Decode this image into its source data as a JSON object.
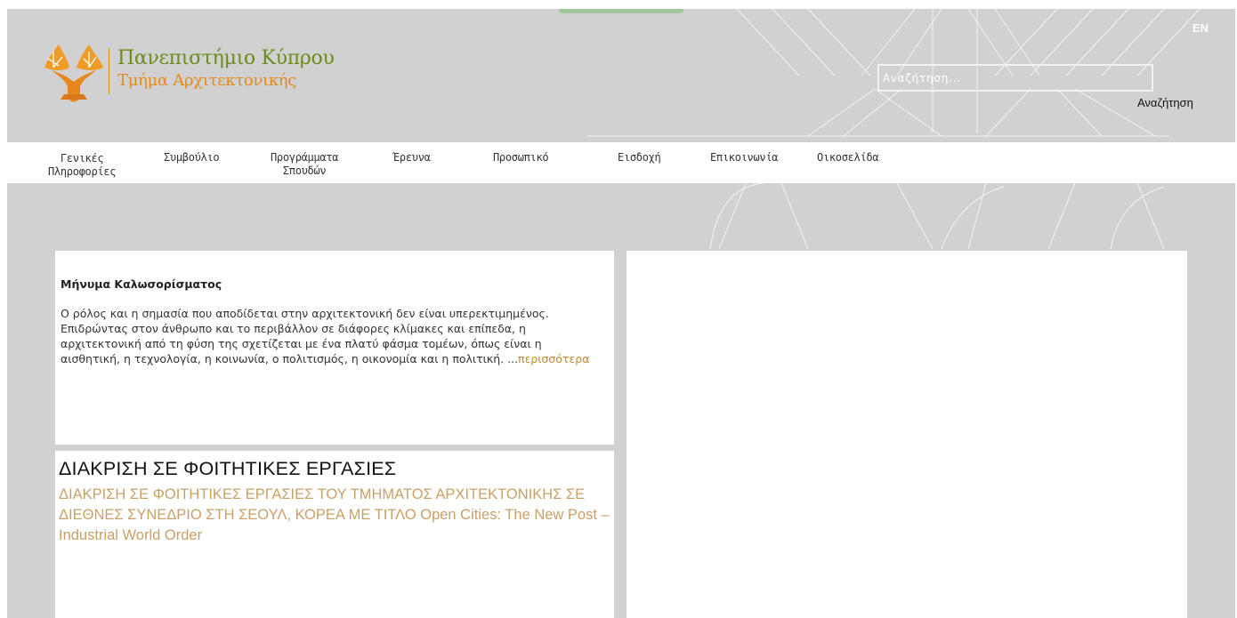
{
  "header": {
    "logo_title": "Πανεπιστήμιο Κύπρου",
    "logo_subtitle": "Τμήμα Αρχιτεκτονικής",
    "logo_icon": "university-trees-logo",
    "language_switch": "EN",
    "search": {
      "placeholder": "Αναζήτηση...",
      "value": "",
      "button_label": "Αναζήτηση"
    }
  },
  "nav": {
    "items": [
      {
        "label": "Γενικές\nΠληροφορίες"
      },
      {
        "label": "Συμβούλιο"
      },
      {
        "label": "Προγράμματα\nΣπουδών"
      },
      {
        "label": "Έρευνα"
      },
      {
        "label": "Προσωπικό"
      },
      {
        "label": "Εισδοχή"
      },
      {
        "label": "Επικοινωνία"
      },
      {
        "label": "Οικοσελίδα"
      }
    ]
  },
  "welcome": {
    "heading": "Μήνυμα Καλωσορίσματος",
    "body": "Ο ρόλος και η σημασία που αποδίδεται στην αρχιτεκτονική δεν είναι υπερεκτιμημένος. Επιδρώντας στον άνθρωπο και το περιβάλλον σε διάφορες κλίμακες και επίπεδα, η αρχιτεκτονική από τη φύση της σχετίζεται με ένα πλατύ φάσμα τομέων, όπως είναι η αισθητική, η τεχνολογία, η κοινωνία, ο πολιτισμός, η οικονομία και η πολιτική. ...",
    "more_link": "περισσότερα"
  },
  "news": {
    "title": "ΔΙΑΚΡΙΣΗ ΣΕ ΦΟΙΤΗΤΙΚΕΣ ΕΡΓΑΣΙΕΣ",
    "link_text": " ΔΙΑΚΡΙΣΗ ΣΕ ΦΟΙΤΗΤΙΚΕΣ ΕΡΓΑΣΙΕΣ ΤΟΥ ΤΜΗΜΑΤΟΣ ΑΡΧΙΤΕΚΤΟΝΙΚΗΣ ΣΕ ΔΙΕΘΝΕΣ ΣΥΝΕΔΡΙΟ ΣΤΗ ΣΕΟΥΛ, ΚΟΡΕΑ ΜΕ ΤΙΤΛΟ Open Cities: The New Post – Industrial World Order"
  },
  "colors": {
    "background": "#d1d1d1",
    "brand_green": "#6c8b1c",
    "brand_orange": "#e38a1b",
    "link_gold": "#c18a2e",
    "news_link": "#c8a068"
  }
}
